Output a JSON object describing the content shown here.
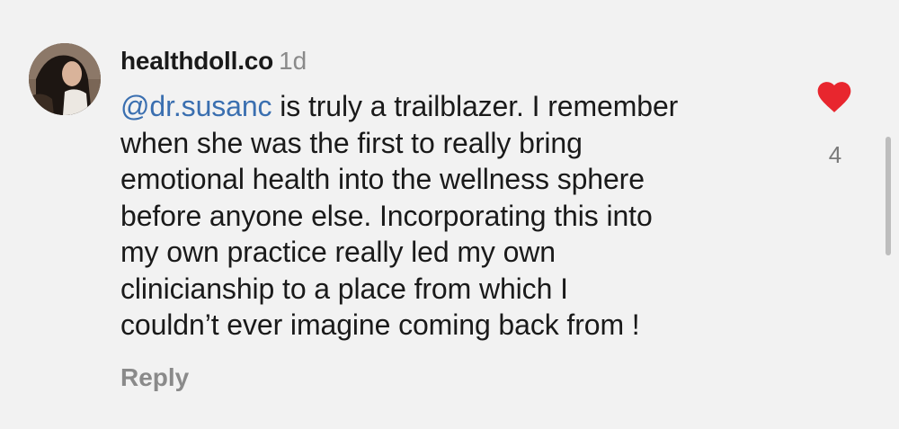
{
  "comment": {
    "username": "healthdoll.co",
    "timestamp": "1d",
    "mention": "@dr.susanc",
    "text_lines": [
      " is truly a trailblazer. I remember",
      "when she was the first to really bring",
      "emotional health into the wellness sphere",
      "before anyone else. Incorporating this into",
      "my own practice really led my own",
      "clinicianship to a place from which I",
      "couldn’t ever imagine coming back from !"
    ],
    "reply_label": "Reply",
    "like_count": "4",
    "like_icon": "heart-icon",
    "liked": true
  },
  "colors": {
    "background": "#f2f2f2",
    "mention": "#3a6fb0",
    "like": "#e8262e",
    "muted": "#8a8a8a"
  }
}
